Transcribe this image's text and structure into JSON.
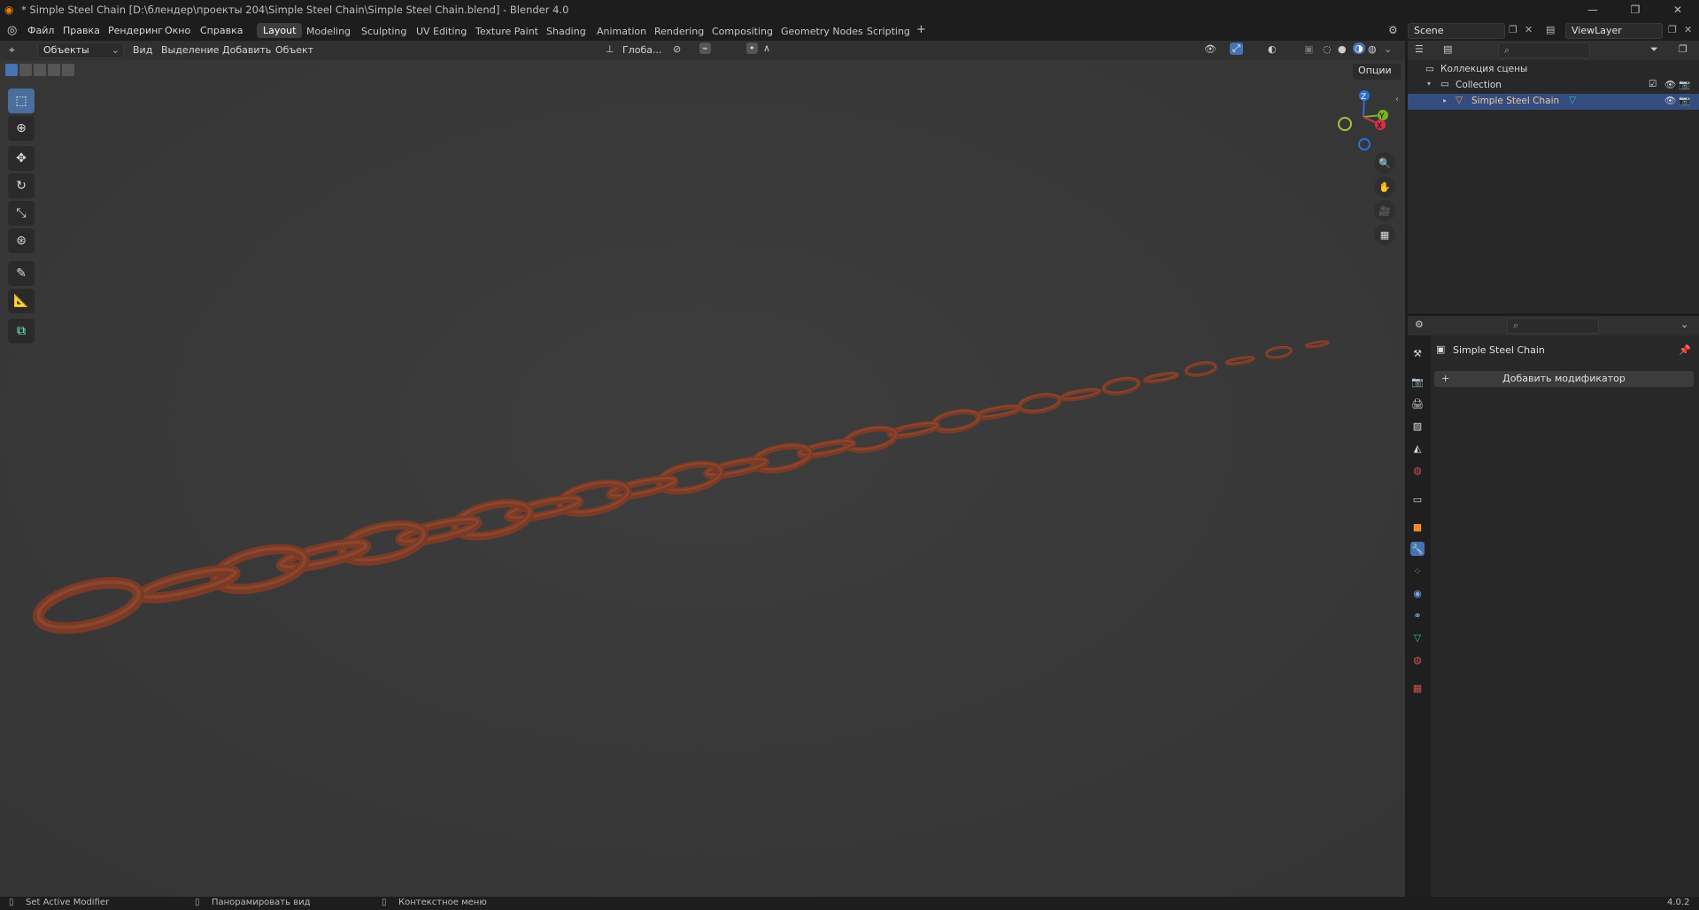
{
  "window": {
    "title": "* Simple Steel Chain [D:\\блендер\\проекты 204\\Simple Steel Chain\\Simple Steel Chain.blend] - Blender 4.0",
    "min": "—",
    "max": "❐",
    "close": "✕"
  },
  "menus": [
    "Файл",
    "Правка",
    "Рендеринг",
    "Окно",
    "Справка"
  ],
  "workspaces": [
    "Layout",
    "Modeling",
    "Sculpting",
    "UV Editing",
    "Texture Paint",
    "Shading",
    "Animation",
    "Rendering",
    "Compositing",
    "Geometry Nodes",
    "Scripting"
  ],
  "workspace_add": "+",
  "scene": {
    "label": "Scene",
    "viewlayer": "ViewLayer"
  },
  "viewport_header": {
    "mode": "Объекты",
    "view": "Вид",
    "select": "Выделение",
    "add": "Добавить",
    "object": "Объект",
    "transform_orientation": "Глоба...",
    "options": "Опции"
  },
  "gizmo": {
    "z": "Z",
    "y": "Y",
    "x": "X"
  },
  "outliner": {
    "scene_collection": "Коллекция сцены",
    "collection": "Collection",
    "object": "Simple Steel Chain"
  },
  "properties": {
    "object_name": "Simple Steel Chain",
    "add_modifier": "Добавить модификатор"
  },
  "statusbar": {
    "left": "Set Active Modifier",
    "mid": "Панорамировать вид",
    "right": "Контекстное меню",
    "version": "4.0.2"
  },
  "colors": {
    "accent": "#4772b3",
    "chain": "#7a3a26",
    "viewport_bg": "#3a3a3a"
  }
}
